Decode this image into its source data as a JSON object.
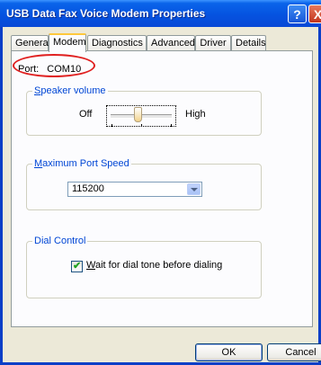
{
  "window": {
    "title": "USB Data Fax Voice Modem Properties",
    "help_glyph": "?",
    "close_glyph": "X"
  },
  "tabs": [
    "General",
    "Modem",
    "Diagnostics",
    "Advanced",
    "Driver",
    "Details"
  ],
  "active_tab": "Modem",
  "port": {
    "label": "Port:",
    "value": "COM10"
  },
  "speaker_volume": {
    "legend_mnemonic": "S",
    "legend_rest": "peaker volume",
    "low_label": "Off",
    "high_label": "High",
    "level_fraction": 0.45
  },
  "max_port_speed": {
    "legend_mnemonic": "M",
    "legend_rest": "aximum Port Speed",
    "selected": "115200"
  },
  "dial_control": {
    "legend": "Dial Control",
    "checkbox_mnemonic": "W",
    "checkbox_rest": "ait for dial tone before dialing",
    "checked": true,
    "check_glyph": "✔"
  },
  "buttons": {
    "ok": "OK",
    "cancel": "Cancel"
  },
  "colors": {
    "titlebar": "#0553e0",
    "group_legend": "#0046d5",
    "highlight_ring": "#e02020",
    "active_tab_accent": "#ffc83c"
  }
}
